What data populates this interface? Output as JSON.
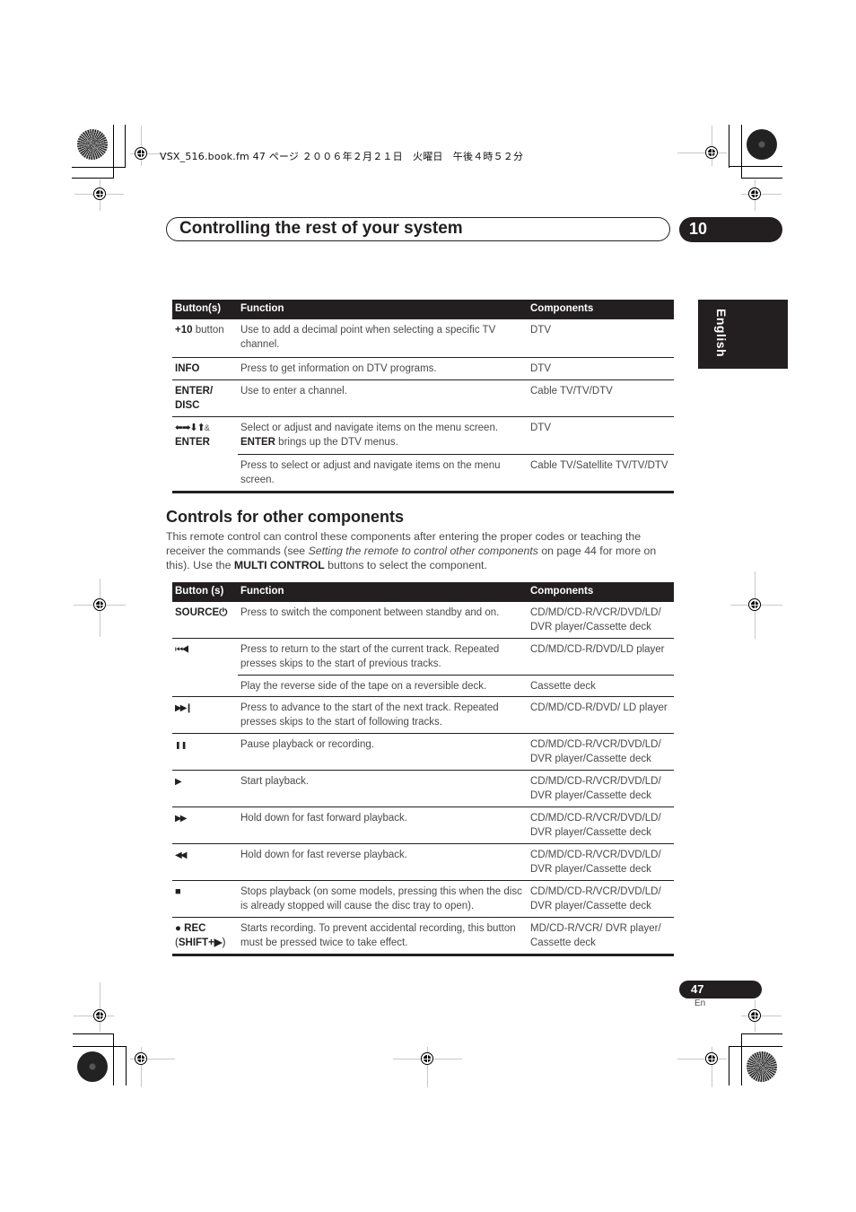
{
  "slug": "VSX_516.book.fm  47 ページ  ２００６年２月２１日　火曜日　午後４時５２分",
  "chapter": {
    "title": "Controlling the rest of your system",
    "number": "10"
  },
  "language_tab": "English",
  "table1": {
    "headers": [
      "Button(s)",
      "Function",
      "Components"
    ],
    "rows": [
      {
        "button_bold": "+10",
        "button_rest": " button",
        "function": "Use to add a decimal point when selecting a specific TV channel.",
        "components": "DTV"
      },
      {
        "button_bold": "INFO",
        "button_rest": "",
        "function": "Press to get information on DTV programs.",
        "components": "DTV"
      },
      {
        "button_bold": "ENTER/ DISC",
        "button_rest": "",
        "function": "Use to enter a channel.",
        "components": "Cable TV/TV/DTV"
      },
      {
        "button_symbols": "⬅➡⬇⬆",
        "button_amp": "&",
        "button_bold": "ENTER",
        "function": "Select or adjust and navigate items on the menu screen.",
        "function_bold": "ENTER",
        "function_rest": " brings up the DTV menus.",
        "components": "DTV"
      },
      {
        "button_bold": "",
        "function": "Press to select or adjust and navigate items on the menu screen.",
        "components": "Cable TV/Satellite TV/TV/DTV"
      }
    ]
  },
  "section": {
    "title": "Controls for other components",
    "intro_1": "This remote control can control these components after entering the proper codes or teaching the receiver the commands (see ",
    "intro_italic": "Setting the remote to control other components",
    "intro_2": " on page 44 for more on this). Use the ",
    "intro_bold": "MULTI CONTROL",
    "intro_3": " buttons to select the component."
  },
  "table2": {
    "headers": [
      "Button (s)",
      "Function",
      "Components"
    ],
    "rows": [
      {
        "button": "SOURCE⏻",
        "icon": "power-icon",
        "function": "Press to switch the component between standby and on.",
        "components": "CD/MD/CD-R/VCR/DVD/LD/ DVR player/Cassette deck"
      },
      {
        "button": "⏮◀",
        "icon": "previous-track-icon",
        "function": "Press to return to the start of the current track. Repeated presses skips to the start of previous tracks.",
        "components": "CD/MD/CD-R/DVD/LD player"
      },
      {
        "button": "",
        "icon": "",
        "function": "Play the reverse side of the tape on a reversible deck.",
        "components": "Cassette deck"
      },
      {
        "button": "▶▶❙",
        "icon": "next-track-icon",
        "function": "Press to advance to the start of the next track. Repeated presses skips to the start of following tracks.",
        "components": "CD/MD/CD-R/DVD/ LD player"
      },
      {
        "button": "❚❚",
        "icon": "pause-icon",
        "function": "Pause playback or recording.",
        "components": "CD/MD/CD-R/VCR/DVD/LD/ DVR player/Cassette deck"
      },
      {
        "button": "▶",
        "icon": "play-icon",
        "function": "Start playback.",
        "components": "CD/MD/CD-R/VCR/DVD/LD/ DVR player/Cassette deck"
      },
      {
        "button": "▶▶",
        "icon": "fast-forward-icon",
        "function": "Hold down for fast forward playback.",
        "components": "CD/MD/CD-R/VCR/DVD/LD/ DVR player/Cassette deck"
      },
      {
        "button": "◀◀",
        "icon": "rewind-icon",
        "function": "Hold down for fast reverse playback.",
        "components": "CD/MD/CD-R/VCR/DVD/LD/ DVR player/Cassette deck"
      },
      {
        "button": "■",
        "icon": "stop-icon",
        "function": "Stops playback (on some models, pressing this when the disc is already stopped will cause the disc tray to open).",
        "components": "CD/MD/CD-R/VCR/DVD/LD/ DVR player/Cassette deck"
      },
      {
        "button": "● REC",
        "button_line2_open": "(",
        "button_line2_bold": "SHIFT+▶",
        "button_line2_close": ")",
        "icon": "record-icon",
        "function": "Starts recording. To prevent accidental recording, this button must be pressed twice to take effect.",
        "components": "MD/CD-R/VCR/ DVR player/ Cassette deck"
      }
    ]
  },
  "footer": {
    "page_number": "47",
    "page_lang": "En"
  }
}
